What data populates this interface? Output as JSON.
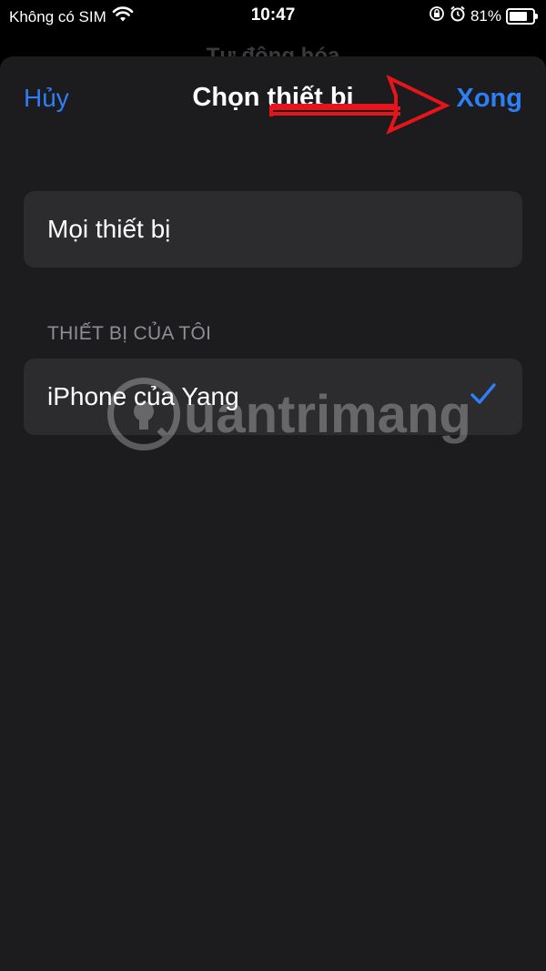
{
  "status_bar": {
    "carrier": "Không có SIM",
    "time": "10:47",
    "battery": "81%",
    "battery_level": 0.81
  },
  "background_title": "Tự động hóa",
  "nav": {
    "cancel_label": "Hủy",
    "title": "Chọn thiết bị",
    "done_label": "Xong"
  },
  "all_devices": {
    "label": "Mọi thiết bị"
  },
  "my_devices": {
    "header": "THIẾT BỊ CỦA TÔI",
    "items": [
      {
        "label": "iPhone của Yang",
        "selected": true
      }
    ]
  },
  "watermark": {
    "text": "uantrimang"
  },
  "colors": {
    "accent": "#2e7ef6",
    "annotation_arrow": "#e8141c",
    "sheet_bg": "#1c1c1e",
    "row_bg": "#2c2c2e"
  }
}
